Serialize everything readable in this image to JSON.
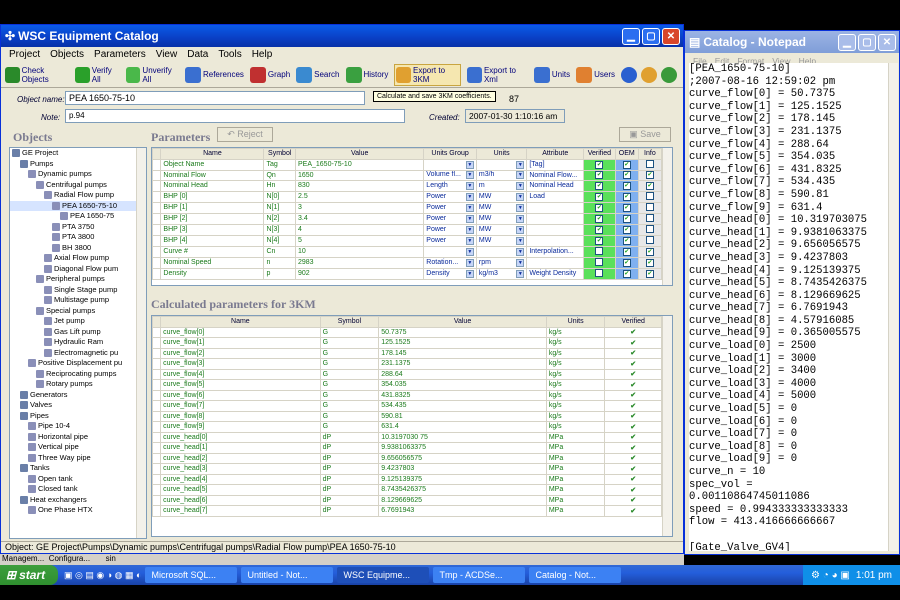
{
  "catalog": {
    "title": "WSC Equipment Catalog",
    "menu": [
      "Project",
      "Objects",
      "Parameters",
      "View",
      "Data",
      "Tools",
      "Help"
    ],
    "toolbar": [
      {
        "label": "Check Objects",
        "icon": "check-objects-icon"
      },
      {
        "label": "Verify All",
        "icon": "verify-icon"
      },
      {
        "label": "Unverify All",
        "icon": "unverify-icon"
      },
      {
        "label": "References",
        "icon": "references-icon"
      },
      {
        "label": "Graph",
        "icon": "graph-icon"
      },
      {
        "label": "Search",
        "icon": "search-icon"
      },
      {
        "label": "History",
        "icon": "history-icon"
      },
      {
        "label": "Export to 3KM",
        "icon": "export-3km-icon"
      },
      {
        "label": "Export to Xml",
        "icon": "export-xml-icon"
      },
      {
        "label": "Units",
        "icon": "units-icon"
      },
      {
        "label": "Users",
        "icon": "users-icon"
      }
    ],
    "tooltip": "Calculate and save 3KM coefficients.",
    "object_name_label": "Object name:",
    "object_name": "PEA 1650-75-10",
    "object_id": "87",
    "note_label": "Note:",
    "note": "p.94",
    "created_label": "Created:",
    "created": "2007-01-30 1:10:16 am",
    "objects_heading": "Objects",
    "parameters_heading": "Parameters",
    "reject_label": "Reject",
    "save_label": "Save",
    "calc_heading": "Calculated parameters for 3KM",
    "status": "Object: GE Project\\Pumps\\Dynamic pumps\\Centrifugal pumps\\Radial Flow pump\\PEA 1650-75-10",
    "tree": [
      {
        "label": "GE Project",
        "level": 0
      },
      {
        "label": "Pumps",
        "level": 1
      },
      {
        "label": "Dynamic pumps",
        "level": 2
      },
      {
        "label": "Centrifugal pumps",
        "level": 3
      },
      {
        "label": "Radial Flow pump",
        "level": 4
      },
      {
        "label": "PEA 1650-75-10",
        "level": 5,
        "selected": true
      },
      {
        "label": "PEA 1650-75",
        "level": 6
      },
      {
        "label": "PTA 3750",
        "level": 5
      },
      {
        "label": "PTA 3800",
        "level": 5
      },
      {
        "label": "BH 3800",
        "level": 5
      },
      {
        "label": "Axial Flow pump",
        "level": 4
      },
      {
        "label": "Diagonal Flow pum",
        "level": 4
      },
      {
        "label": "Peripheral pumps",
        "level": 3
      },
      {
        "label": "Single Stage pump",
        "level": 4
      },
      {
        "label": "Multistage pump",
        "level": 4
      },
      {
        "label": "Special pumps",
        "level": 3
      },
      {
        "label": "Jet pump",
        "level": 4
      },
      {
        "label": "Gas Lift pump",
        "level": 4
      },
      {
        "label": "Hydraulic Ram",
        "level": 4
      },
      {
        "label": "Electromagnetic pu",
        "level": 4
      },
      {
        "label": "Positive Displacement pu",
        "level": 2
      },
      {
        "label": "Reciprocating pumps",
        "level": 3
      },
      {
        "label": "Rotary pumps",
        "level": 3
      },
      {
        "label": "Generators",
        "level": 1
      },
      {
        "label": "Valves",
        "level": 1
      },
      {
        "label": "Pipes",
        "level": 1
      },
      {
        "label": "Pipe 10-4",
        "level": 2
      },
      {
        "label": "Horizontal pipe",
        "level": 2
      },
      {
        "label": "Vertical pipe",
        "level": 2
      },
      {
        "label": "Three Way pipe",
        "level": 2
      },
      {
        "label": "Tanks",
        "level": 1
      },
      {
        "label": "Open tank",
        "level": 2
      },
      {
        "label": "Closed tank",
        "level": 2
      },
      {
        "label": "Heat exchangers",
        "level": 1
      },
      {
        "label": "One Phase HTX",
        "level": 2
      }
    ],
    "params_columns": [
      "Name",
      "Symbol",
      "Value",
      "Units Group",
      "Units",
      "Attribute",
      "Verified",
      "OEM",
      "Info"
    ],
    "params": [
      [
        "Object Name",
        "Tag",
        "PEA_1650-75-10",
        "",
        "",
        "[Tag]"
      ],
      [
        "Nominal Flow",
        "Qn",
        "1650",
        "Volume fl...",
        "m3/h",
        "Nominal Flow..."
      ],
      [
        "Nominal Head",
        "Hn",
        "830",
        "Length",
        "m",
        "Nominal Head"
      ],
      [
        "BHP [0]",
        "N[0]",
        "2.5",
        "Power",
        "MW",
        "Load"
      ],
      [
        "BHP [1]",
        "N[1]",
        "3",
        "Power",
        "MW",
        ""
      ],
      [
        "BHP [2]",
        "N[2]",
        "3.4",
        "Power",
        "MW",
        ""
      ],
      [
        "BHP [3]",
        "N[3]",
        "4",
        "Power",
        "MW",
        ""
      ],
      [
        "BHP [4]",
        "N[4]",
        "5",
        "Power",
        "MW",
        ""
      ],
      [
        "Curve #",
        "Cn",
        "10",
        "",
        "",
        "Interpolation..."
      ],
      [
        "Nominal Speed",
        "n",
        "2983",
        "Rotation...",
        "rpm",
        ""
      ],
      [
        "Density",
        "p",
        "902",
        "Density",
        "kg/m3",
        "Weight Density"
      ]
    ],
    "calc_columns": [
      "Name",
      "Symbol",
      "Value",
      "Units",
      "Verified"
    ],
    "calc": [
      [
        "curve_flow[0]",
        "G",
        "50.7375",
        "kg/s"
      ],
      [
        "curve_flow[1]",
        "G",
        "125.1525",
        "kg/s"
      ],
      [
        "curve_flow[2]",
        "G",
        "178.145",
        "kg/s"
      ],
      [
        "curve_flow[3]",
        "G",
        "231.1375",
        "kg/s"
      ],
      [
        "curve_flow[4]",
        "G",
        "288.64",
        "kg/s"
      ],
      [
        "curve_flow[5]",
        "G",
        "354.035",
        "kg/s"
      ],
      [
        "curve_flow[6]",
        "G",
        "431.8325",
        "kg/s"
      ],
      [
        "curve_flow[7]",
        "G",
        "534.435",
        "kg/s"
      ],
      [
        "curve_flow[8]",
        "G",
        "590.81",
        "kg/s"
      ],
      [
        "curve_flow[9]",
        "G",
        "631.4",
        "kg/s"
      ],
      [
        "curve_head[0]",
        "dP",
        "10.3197030 75",
        "MPa"
      ],
      [
        "curve_head[1]",
        "dP",
        "9.9381063375",
        "MPa"
      ],
      [
        "curve_head[2]",
        "dP",
        "9.656056575",
        "MPa"
      ],
      [
        "curve_head[3]",
        "dP",
        "9.4237803",
        "MPa"
      ],
      [
        "curve_head[4]",
        "dP",
        "9.125139375",
        "MPa"
      ],
      [
        "curve_head[5]",
        "dP",
        "8.7435426375",
        "MPa"
      ],
      [
        "curve_head[6]",
        "dP",
        "8.129669625",
        "MPa"
      ],
      [
        "curve_head[7]",
        "dP",
        "6.7691943",
        "MPa"
      ]
    ]
  },
  "notepad": {
    "title": "Catalog - Notepad",
    "menu": [
      "File",
      "Edit",
      "Format",
      "View",
      "Help"
    ],
    "text": "[PEA_1650-75-10]\n;2007-08-16 12:59:02 pm\ncurve_flow[0] = 50.7375\ncurve_flow[1] = 125.1525\ncurve_flow[2] = 178.145\ncurve_flow[3] = 231.1375\ncurve_flow[4] = 288.64\ncurve_flow[5] = 354.035\ncurve_flow[6] = 431.8325\ncurve_flow[7] = 534.435\ncurve_flow[8] = 590.81\ncurve_flow[9] = 631.4\ncurve_head[0] = 10.319703075\ncurve_head[1] = 9.9381063375\ncurve_head[2] = 9.656056575\ncurve_head[3] = 9.4237803\ncurve_head[4] = 9.125139375\ncurve_head[5] = 8.7435426375\ncurve_head[6] = 8.129669625\ncurve_head[7] = 6.7691943\ncurve_head[8] = 4.57916085\ncurve_head[9] = 0.365005575\ncurve_load[0] = 2500\ncurve_load[1] = 3000\ncurve_load[2] = 3400\ncurve_load[3] = 4000\ncurve_load[4] = 5000\ncurve_load[5] = 0\ncurve_load[6] = 0\ncurve_load[7] = 0\ncurve_load[8] = 0\ncurve_load[9] = 0\ncurve_n = 10\nspec_vol =\n0.00110864745011086\nspeed = 0.994333333333333\nflow = 413.416666666667\n\n[Gate_Valve_GV4]"
  },
  "behind": {
    "text": "Managem...  Configura...       sin"
  },
  "taskbar": {
    "start": "start",
    "tasks": [
      "Microsoft SQL...",
      "Untitled - Not...",
      "WSC Equipme...",
      "Tmp - ACDSe...",
      "Catalog - Not..."
    ],
    "active": 2,
    "clock": "1:01 pm"
  }
}
